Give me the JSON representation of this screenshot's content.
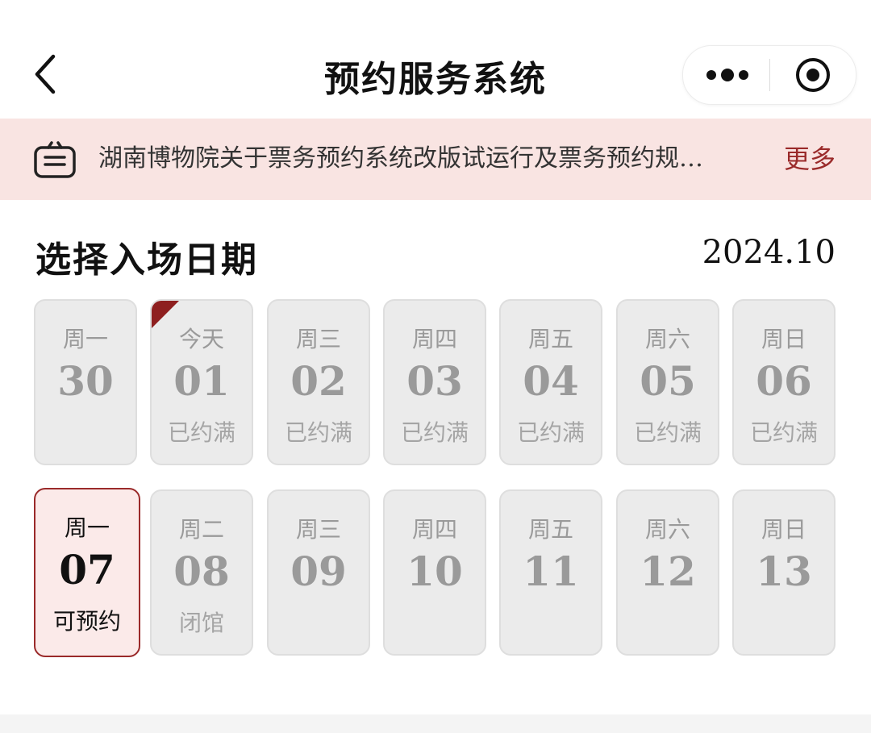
{
  "navbar": {
    "title": "预约服务系统",
    "back_icon": "chevron-left-icon",
    "more_icon": "more-dots-icon",
    "close_icon": "close-target-icon"
  },
  "notice": {
    "text": "湖南博物院关于票务预约系统改版试运行及票务预约规…",
    "more_label": "更多",
    "icon": "announcement-icon",
    "background": "#f9e4e2",
    "accent": "#9a2a2a"
  },
  "date_picker": {
    "title": "选择入场日期",
    "month": "2024.10",
    "week1": [
      {
        "weekday": "周一",
        "date": "30",
        "status": ""
      },
      {
        "weekday": "今天",
        "date": "01",
        "status": "已约满",
        "today": true
      },
      {
        "weekday": "周三",
        "date": "02",
        "status": "已约满"
      },
      {
        "weekday": "周四",
        "date": "03",
        "status": "已约满"
      },
      {
        "weekday": "周五",
        "date": "04",
        "status": "已约满"
      },
      {
        "weekday": "周六",
        "date": "05",
        "status": "已约满"
      },
      {
        "weekday": "周日",
        "date": "06",
        "status": "已约满"
      }
    ],
    "week2": [
      {
        "weekday": "周一",
        "date": "07",
        "status": "可预约",
        "selected": true
      },
      {
        "weekday": "周二",
        "date": "08",
        "status": "闭馆"
      },
      {
        "weekday": "周三",
        "date": "09",
        "status": ""
      },
      {
        "weekday": "周四",
        "date": "10",
        "status": ""
      },
      {
        "weekday": "周五",
        "date": "11",
        "status": ""
      },
      {
        "weekday": "周六",
        "date": "12",
        "status": ""
      },
      {
        "weekday": "周日",
        "date": "13",
        "status": ""
      }
    ]
  },
  "colors": {
    "selected_border": "#9a2a2a",
    "today_flag": "#8e1f1f",
    "disabled_bg": "#ebebeb",
    "disabled_text": "#9a9a9a"
  }
}
